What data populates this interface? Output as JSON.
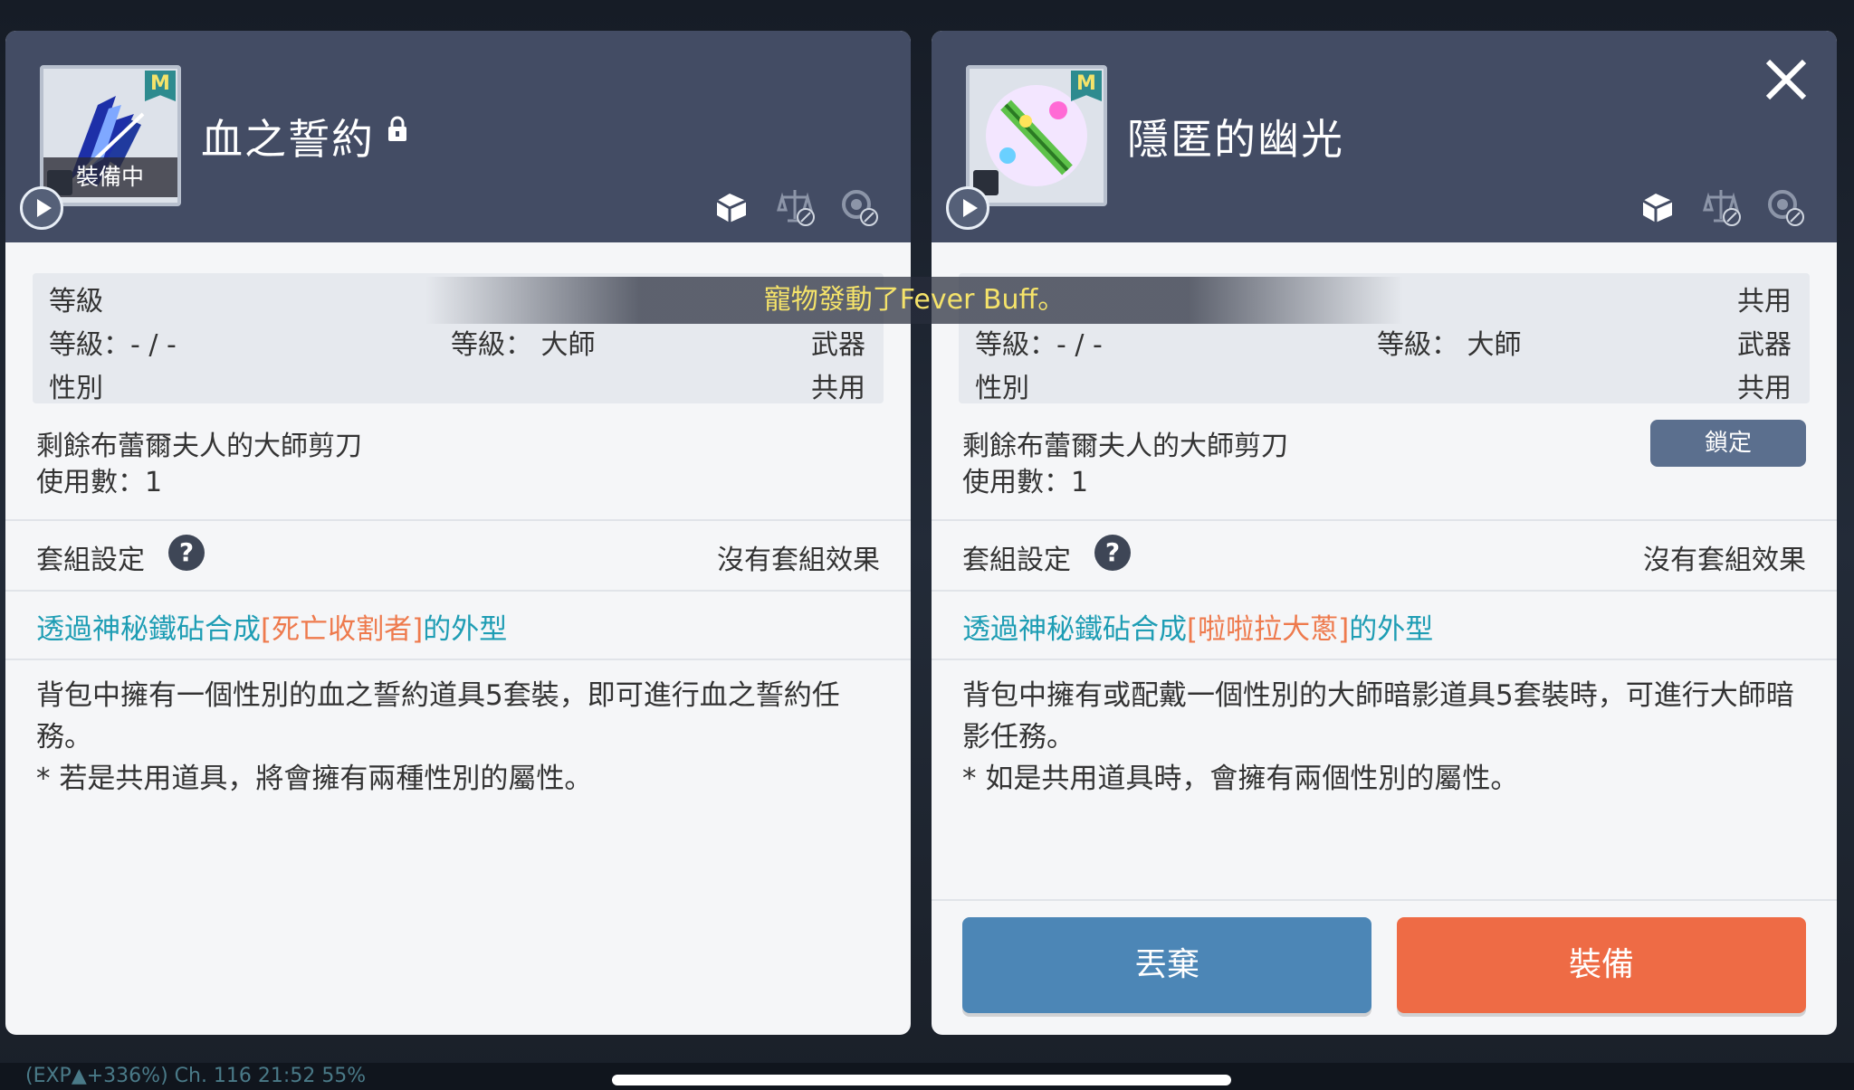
{
  "left_item": {
    "title": "血之誓約",
    "badge": "M",
    "equipped_tag": "裝備中",
    "stats": {
      "row1_label": "等級",
      "row2_label": "等級：- / -",
      "row2_mid": "等級： 大師",
      "row2_right": "武器",
      "row3_label": "性別",
      "row3_right": "共用"
    },
    "shears_line": "剩餘布蕾爾夫人的大師剪刀",
    "uses_line": "使用數：1",
    "set_label": "套組設定",
    "set_help": "?",
    "set_effect": "沒有套組效果",
    "transmog_prefix": "透過神秘鐵砧合成",
    "transmog_item": "[死亡收割者]",
    "transmog_suffix": "的外型",
    "desc_line1": "背包中擁有一個性別的血之誓約道具5套裝，即可進行血之誓約任務。",
    "desc_line2": "* 若是共用道具，將會擁有兩種性別的屬性。"
  },
  "right_item": {
    "title": "隱匿的幽光",
    "badge": "M",
    "stats": {
      "row1_right": "共用",
      "row2_label": "等級：- / -",
      "row2_mid": "等級： 大師",
      "row2_right": "武器",
      "row3_label": "性別",
      "row3_right": "共用"
    },
    "lock_button": "鎖定",
    "shears_line": "剩餘布蕾爾夫人的大師剪刀",
    "uses_line": "使用數：1",
    "set_label": "套組設定",
    "set_help": "?",
    "set_effect": "沒有套組效果",
    "transmog_prefix": "透過神秘鐵砧合成",
    "transmog_item": "[啦啦拉大蔥]",
    "transmog_suffix": "的外型",
    "desc_line1": "背包中擁有或配戴一個性別的大師暗影道具5套裝時，可進行大師暗影任務。",
    "desc_line2": "* 如是共用道具時，會擁有兩個性別的屬性。",
    "discard_button": "丟棄",
    "equip_button": "裝備"
  },
  "toast": "寵物發動了Fever Buff。",
  "statusbar": {
    "text": "(EXP▲+336%)  Ch. 116  21:52          55%"
  },
  "icons": {
    "header": [
      "share-icon",
      "compare-disabled-icon",
      "refresh-disabled-icon"
    ],
    "close": "close-icon",
    "lock": "lock-icon",
    "play": "play-icon"
  },
  "colors": {
    "header_bg": "#434c64",
    "accent_teal": "#1e9db4",
    "accent_orange": "#ee7a4d",
    "discard_blue": "#4c86b6",
    "equip_orange": "#ee6b45",
    "toast_yellow": "#f5e36a"
  }
}
